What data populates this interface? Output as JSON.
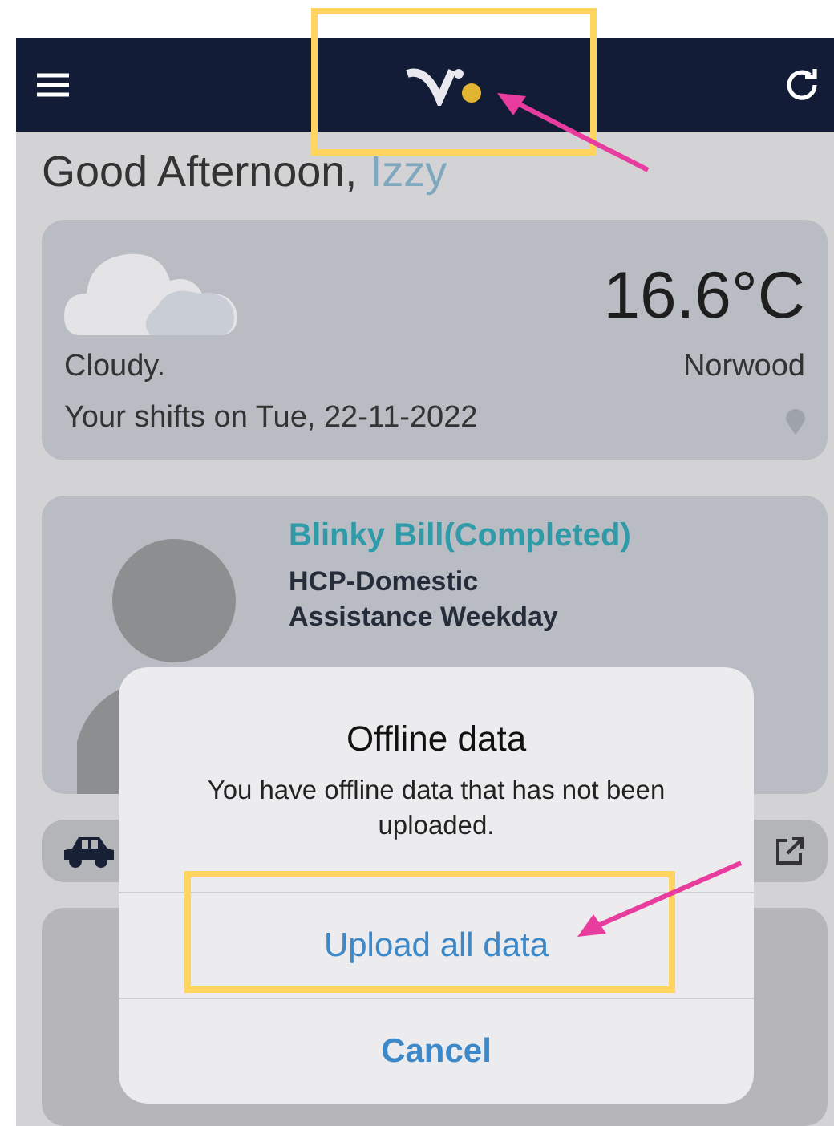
{
  "greeting": {
    "salutation": "Good Afternoon,",
    "name": "Izzy"
  },
  "weather": {
    "temperature": "16.6°C",
    "condition": "Cloudy.",
    "location": "Norwood",
    "shifts_line": "Your shifts on Tue, 22-11-2022"
  },
  "shifts": [
    {
      "client": "Blinky Bill(Completed)",
      "service_lines": [
        "HCP-Domestic",
        "Assistance Weekday"
      ]
    }
  ],
  "dialog": {
    "title": "Offline data",
    "message": "You have offline data that has not been uploaded.",
    "actions": [
      {
        "label": "Upload all data",
        "kind": "default"
      },
      {
        "label": "Cancel",
        "kind": "cancel"
      }
    ]
  }
}
